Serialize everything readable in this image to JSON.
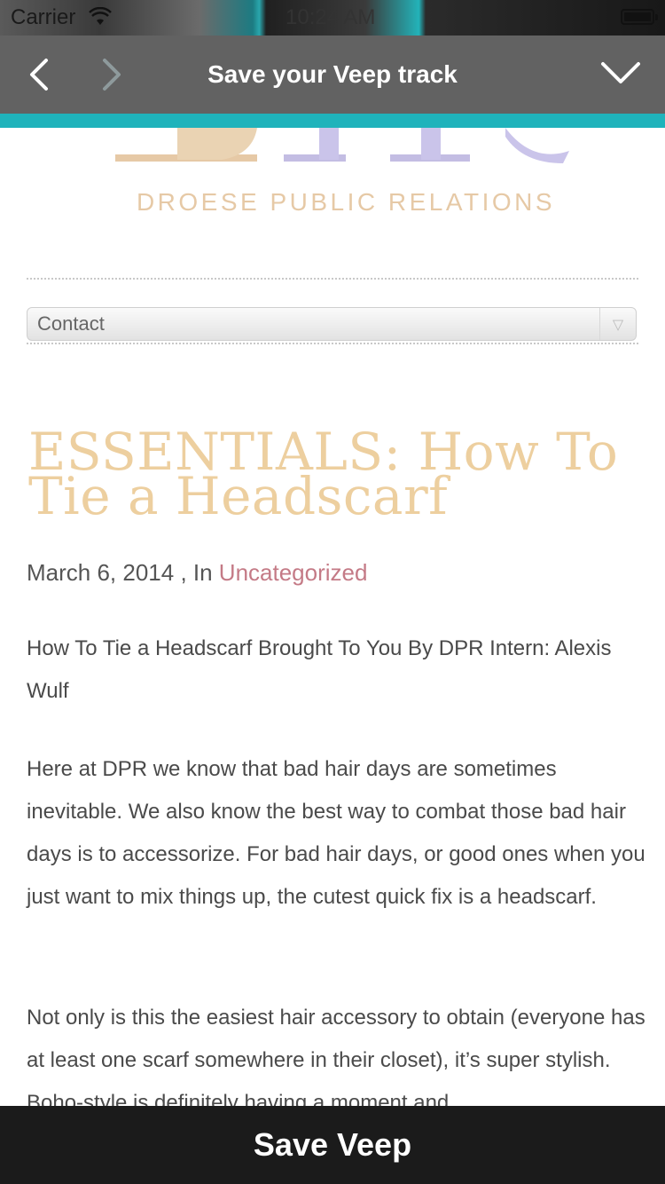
{
  "status_bar": {
    "carrier": "Carrier",
    "time": "10:24 AM",
    "wifi_icon": "wifi-icon",
    "battery_icon": "battery-icon"
  },
  "toolbar": {
    "title": "Save your Veep track",
    "back_icon": "chevron-left-icon",
    "forward_icon": "chevron-right-icon",
    "collapse_icon": "chevron-down-icon",
    "accent_color": "#1fb3bb"
  },
  "page": {
    "logo_tagline": "DROESE PUBLIC RELATIONS",
    "menu_select": {
      "selected": "Contact",
      "arrow": "▽"
    },
    "post": {
      "title": "ESSENTIALS: How To Tie a Headscarf",
      "date": "March 6, 2014",
      "in_label": " , In ",
      "category": "Uncategorized",
      "paragraphs": [
        "How To Tie a Headscarf Brought To You By DPR Intern: Alexis Wulf",
        "Here at DPR we know that bad hair days are sometimes inevitable. We also know the best way to combat those bad hair days is to accessorize. For bad hair days, or good ones when you just want to mix things up, the cutest quick fix is a headscarf.",
        "Not only is this the easiest hair accessory to obtain (everyone has at least one scarf somewhere in their closet), it’s super stylish. Boho-style is definitely having a moment and"
      ]
    },
    "colors": {
      "title": "#edcf9f",
      "category_link": "#c47a86",
      "logo_tan": "#e6c9a6",
      "logo_lavender": "#c3bde3"
    }
  },
  "save_bar": {
    "label": "Save Veep"
  }
}
